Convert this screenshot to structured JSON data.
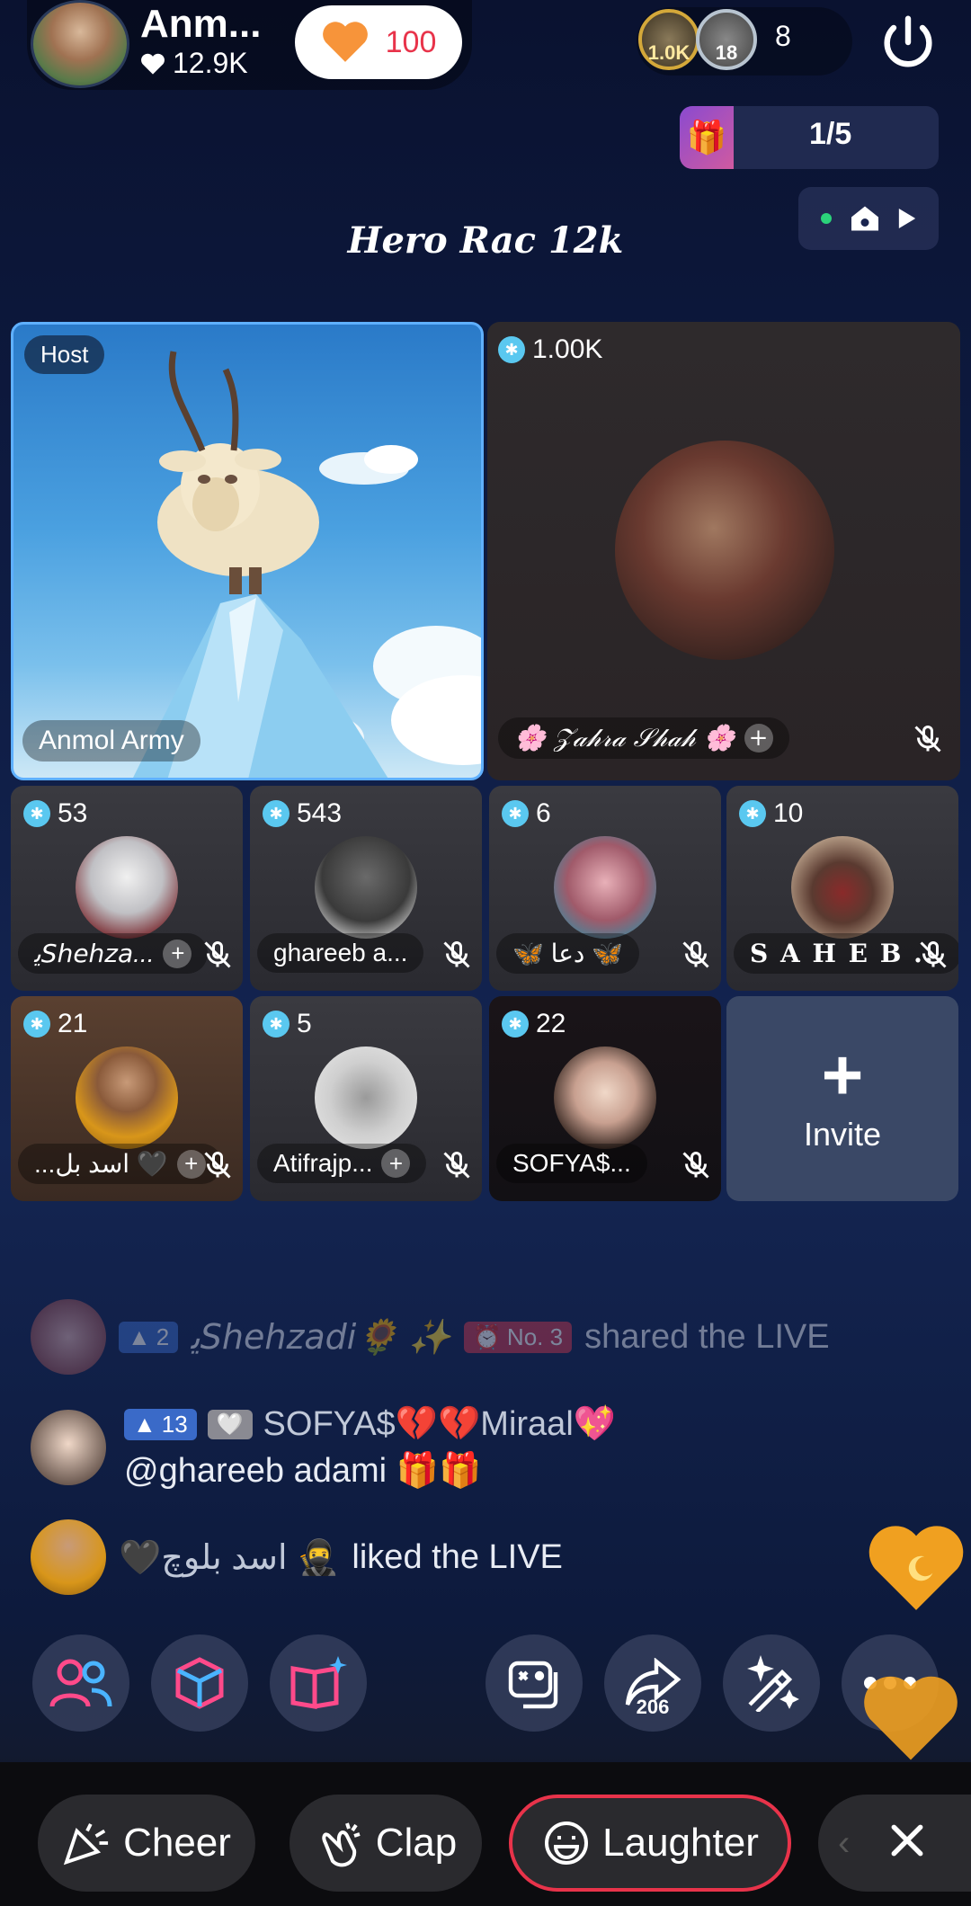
{
  "host": {
    "name": "Anm...",
    "likes": "12.9K",
    "like_button_count": "100"
  },
  "viewers": {
    "badge1": "1.0K",
    "badge2": "18",
    "count": "8"
  },
  "gift_progress": "1/5",
  "room_title": "Hero Rac 12k",
  "tiles": {
    "host": {
      "tag": "Host",
      "name": "Anmol Army"
    },
    "big2": {
      "score": "1.00K",
      "name": "🌸 𝒵𝒶𝒽𝓇𝒶 𝒮𝒽𝒶𝒽 🌸"
    },
    "row1": [
      {
        "score": "53",
        "name": "ﯾ𝘚𝘩𝘦𝘩𝘻𝘢..."
      },
      {
        "score": "543",
        "name": "ghareeb a..."
      },
      {
        "score": "6",
        "name": "🦋 دعا 🦋"
      },
      {
        "score": "10",
        "name": "S A H E B ..."
      }
    ],
    "row2": [
      {
        "score": "21",
        "name": "...اسد بل 🖤"
      },
      {
        "score": "5",
        "name": "Atifrajp..."
      },
      {
        "score": "22",
        "name": "SOFYA$..."
      }
    ],
    "invite_label": "Invite"
  },
  "chat": [
    {
      "level": "2",
      "user": "ﯾ𝘚𝘩𝘦𝘩𝘻𝘢𝘥𝘪🌻 ✨",
      "rank": "No. 3",
      "text": "shared the LIVE"
    },
    {
      "level": "13",
      "user": "SOFYA$💔💔Miraal💖",
      "text": "@ghareeb adami 🎁🎁"
    },
    {
      "user": "🖤اسد بلوچ 🥷",
      "text": "liked the LIVE"
    }
  ],
  "share_count": "206",
  "reactions": {
    "cheer": "Cheer",
    "clap": "Clap",
    "laughter": "Laughter"
  },
  "colors": {
    "accent": "#e8334a",
    "badge": "#5ac8f0",
    "level_chip": "#3a6ac8"
  }
}
